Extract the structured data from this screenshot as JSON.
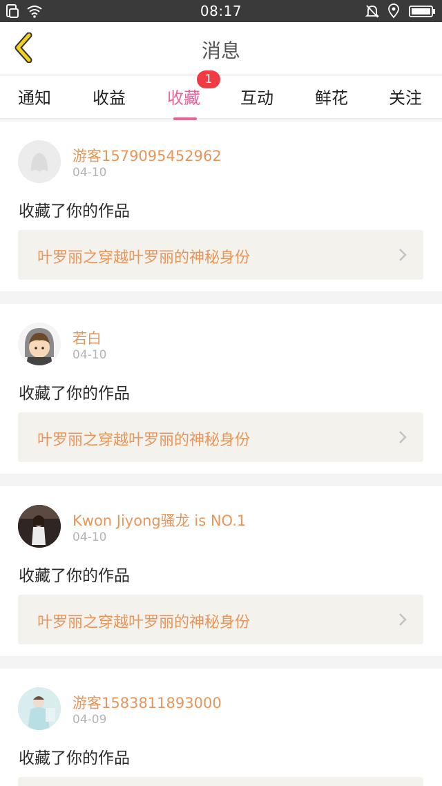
{
  "status_bar": {
    "time": "08:17",
    "left_icons": [
      "sim-icon",
      "wifi-icon"
    ],
    "right_icons": [
      "bell-muted-icon",
      "location-icon",
      "battery-icon"
    ]
  },
  "header": {
    "title": "消息"
  },
  "tabs": [
    {
      "label": "通知",
      "active": false
    },
    {
      "label": "收益",
      "active": false
    },
    {
      "label": "收藏",
      "active": true,
      "badge": "1"
    },
    {
      "label": "互动",
      "active": false
    },
    {
      "label": "鲜花",
      "active": false
    },
    {
      "label": "关注",
      "active": false
    }
  ],
  "feed": [
    {
      "username": "游客1579095452962",
      "date": "04-10",
      "action": "收藏了你的作品",
      "work_title": "叶罗丽之穿越叶罗丽的神秘身份",
      "avatar": "default-avatar"
    },
    {
      "username": "若白",
      "date": "04-10",
      "action": "收藏了你的作品",
      "work_title": "叶罗丽之穿越叶罗丽的神秘身份",
      "avatar": "cartoon-avatar"
    },
    {
      "username": "Kwon Jiyong骚龙 is NO.1",
      "date": "04-10",
      "action": "收藏了你的作品",
      "work_title": "叶罗丽之穿越叶罗丽的神秘身份",
      "avatar": "photo-avatar"
    },
    {
      "username": "游客1583811893000",
      "date": "04-09",
      "action": "收藏了你的作品",
      "work_title": "",
      "avatar": "photo-avatar-2"
    }
  ],
  "colors": {
    "accent_pink": "#e8649a",
    "username_orange": "#e8955a",
    "badge_red": "#f23a43",
    "back_arrow": "#f2d21f"
  }
}
